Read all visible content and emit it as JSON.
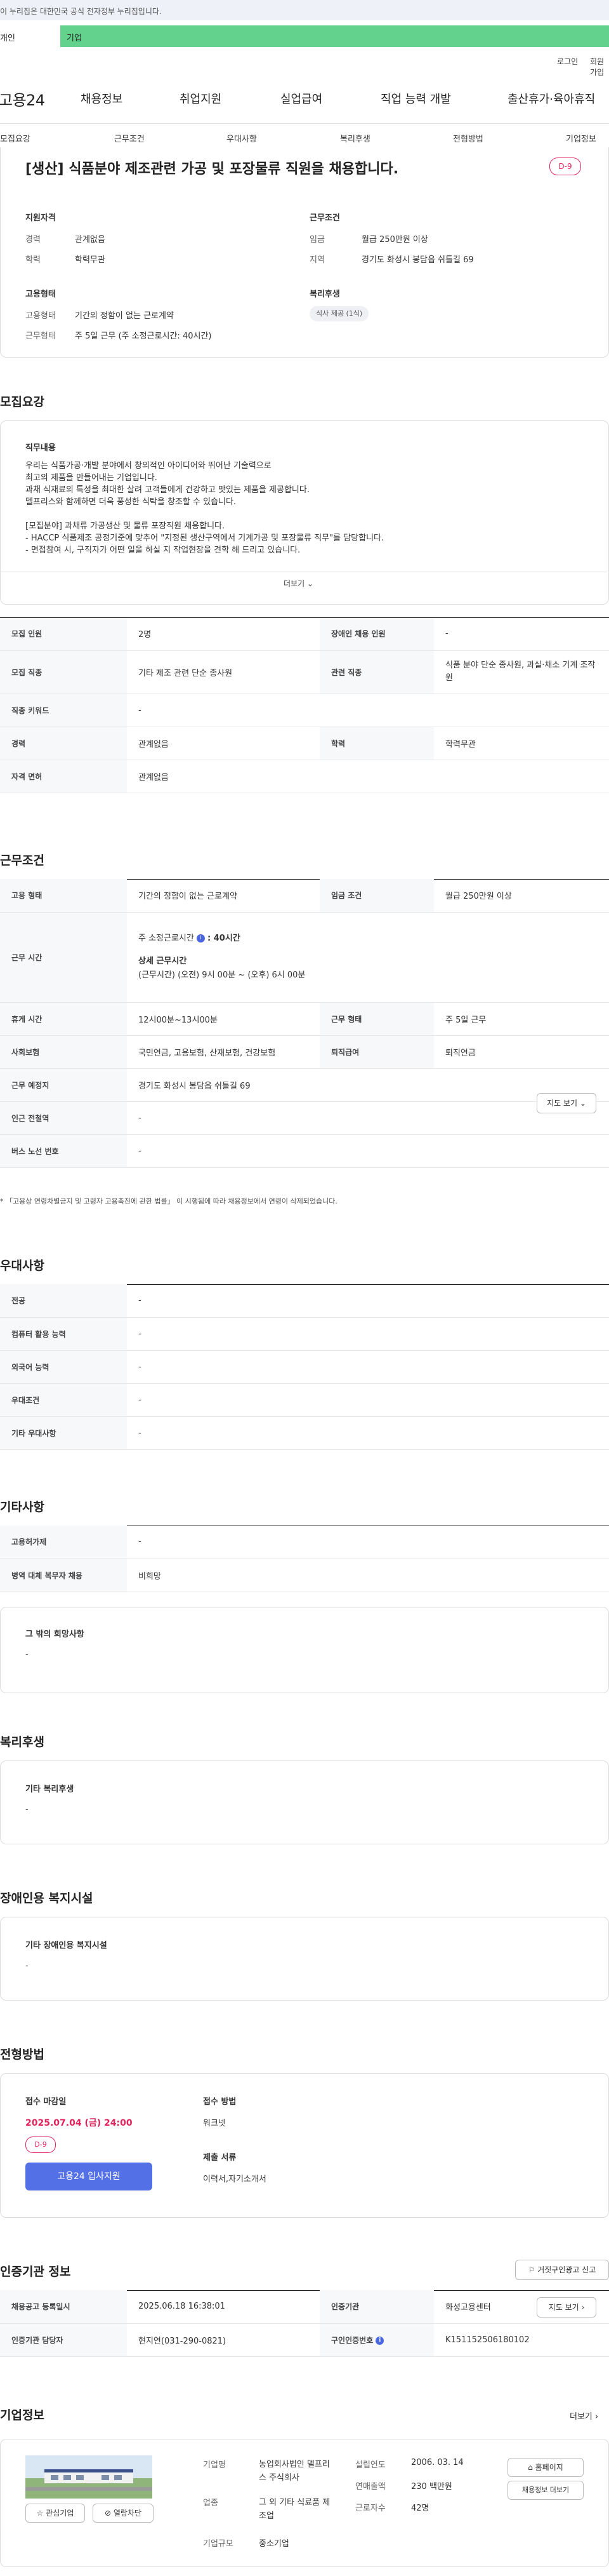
{
  "banner": {
    "text": "이 누리집은 대한민국 공식 전자정부 누리집입니다."
  },
  "tabs": {
    "main": "개인",
    "biz": "기업"
  },
  "util": {
    "login": "로그인",
    "signup": "회원가입"
  },
  "header": {
    "logo": "고용24",
    "gnb": [
      "채용정보",
      "취업지원",
      "실업급여",
      "직업 능력 개발",
      "출산휴가·육아휴직"
    ]
  },
  "lnb": [
    "모집요강",
    "근무조건",
    "우대사항",
    "복리후생",
    "전형방법",
    "기업정보"
  ],
  "job": {
    "title": "[생산] 식품분야 제조관련 가공 및 포장물류 직원을 채용합니다.",
    "dday": "D-9",
    "qual_title": "지원자격",
    "qual": [
      {
        "label": "경력",
        "value": "관계없음"
      },
      {
        "label": "학력",
        "value": "학력무관"
      }
    ],
    "cond_title": "근무조건",
    "cond": [
      {
        "label": "임금",
        "value": "월급 250만원 이상"
      },
      {
        "label": "지역",
        "value": "경기도 화성시 봉담읍 쉬틀길 69"
      }
    ],
    "emp_title": "고용형태",
    "emp": [
      {
        "label": "고용형태",
        "value": "기간의 정함이 없는 근로계약"
      },
      {
        "label": "근무형태",
        "value": "주 5일 근무 (주 소정근로시간: 40시간)"
      }
    ],
    "welfare_title": "복리후생",
    "welfare_chip": "식사 제공 (1식)"
  },
  "recruit": {
    "title": "모집요강",
    "duty_title": "직무내용",
    "desc": [
      "우리는 식품가공·개발 분야에서 창의적인 아이디어와 뛰어난 기술력으로",
      "최고의 제품을 만들어내는 기업입니다.",
      "과채 식재료의 특성을 최대한 살려 고객들에게 건강하고 맛있는 제품을 제공합니다.",
      "델프리스와 함께하면 더욱 풍성한 식탁을 창조할 수 있습니다.",
      "",
      "[모집분야] 과채류 가공생산 및 물류 포장직원 채용합니다.",
      "- HACCP 식품제조 공정기준에 맞추어 \"지정된 생산구역에서 기계가공 및 포장물류 직무\"를 담당합니다.",
      "- 면접참여 시, 구직자가 어떤 일을 하실 지 작업현장을 견학 해 드리고 있습니다."
    ],
    "more": "더보기",
    "rows": [
      [
        "모집 인원",
        "2명",
        "장애인 채용 인원",
        "-"
      ],
      [
        "모집 직종",
        "기타 제조 관련 단순 종사원",
        "관련 직종",
        "식품 분야 단순 종사원, 과실·채소 기계 조작원"
      ],
      [
        "직종 키워드",
        "-",
        "",
        ""
      ],
      [
        "경력",
        "관계없음",
        "학력",
        "학력무관"
      ],
      [
        "자격 면허",
        "관계없음",
        "",
        ""
      ]
    ]
  },
  "work": {
    "title": "근무조건",
    "emp_type_label": "고용 형태",
    "emp_type": "기간의 정함이 없는 근로계약",
    "wage_label": "임금 조건",
    "wage": "월급 250만원 이상",
    "hours_label": "근무 시간",
    "weekly": "주 소정근로시간",
    "weekly_val": ": 40시간",
    "detail_title": "상세 근무시간",
    "detail": "(근무시간) (오전) 9시 00분 ~ (오후) 6시 00분",
    "rows": [
      [
        "휴게 시간",
        "12시00분~13시00분",
        "근무 형태",
        "주 5일 근무"
      ],
      [
        "사회보험",
        "국민연금, 고용보험, 산재보험, 건강보험",
        "퇴직급여",
        "퇴직연금"
      ]
    ],
    "place_label": "근무 예정지",
    "place": "경기도 화성시 봉담읍 쉬틀길 69",
    "map_btn": "지도 보기",
    "station_label": "인근 전철역",
    "station": "-",
    "bus_label": "버스 노선 번호",
    "bus": "-",
    "note": "* 「고용상 연령차별금지 및 고령자 고용촉진에 관한 법률」 이 시행됨에 따라 채용정보에서 연령이 삭제되었습니다."
  },
  "pref": {
    "title": "우대사항",
    "rows": [
      [
        "전공",
        "-"
      ],
      [
        "컴퓨터 활용 능력",
        "-"
      ],
      [
        "외국어 능력",
        "-"
      ],
      [
        "우대조건",
        "-"
      ],
      [
        "기타 우대사항",
        "-"
      ]
    ]
  },
  "etc": {
    "title": "기타사항",
    "rows": [
      [
        "고용허가제",
        "-"
      ],
      [
        "병역 대체 복무자 채용",
        "비희망"
      ]
    ],
    "wish_title": "그 밖의 희망사항",
    "wish": "-"
  },
  "benefit": {
    "title": "복리후생",
    "sub": "기타 복리후생",
    "val": "-"
  },
  "disab": {
    "title": "장애인용 복지시설",
    "sub": "기타 장애인용 복지시설",
    "val": "-"
  },
  "apply": {
    "title": "전형방법",
    "deadline_title": "접수 마감일",
    "deadline": "2025.07.04 (금) 24:00",
    "dday": "D-9",
    "btn": "고용24 입사지원",
    "method_title": "접수 방법",
    "method": "워크넷",
    "docs_title": "제출 서류",
    "docs": "이력서,자기소개서"
  },
  "agency": {
    "title": "인증기관 정보",
    "report": "거짓구인광고 신고",
    "reg_label": "채용공고 등록일시",
    "reg": "2025.06.18 16:38:01",
    "org_label": "인증기관",
    "org": "화성고용센터",
    "map_btn": "지도 보기",
    "mgr_label": "인증기관 담당자",
    "mgr": "현지연(031-290-0821)",
    "no_label": "구인인증번호",
    "no": "K151152506180102"
  },
  "company": {
    "title": "기업정보",
    "more": "더보기",
    "fav": "관심기업",
    "block": "열람차단",
    "name_label": "기업명",
    "name": "농업회사법인 델프리스 주식회사",
    "biz_label": "업종",
    "biz": "그 외 기타 식료품 제조업",
    "size_label": "기업규모",
    "size": "중소기업",
    "est_label": "설립연도",
    "est": "2006. 03. 14",
    "sales_label": "연매출액",
    "sales": "230 백만원",
    "staff_label": "근로자수",
    "staff": "42명",
    "home_btn": "홈페이지",
    "jobs_btn": "채용정보 더보기"
  }
}
